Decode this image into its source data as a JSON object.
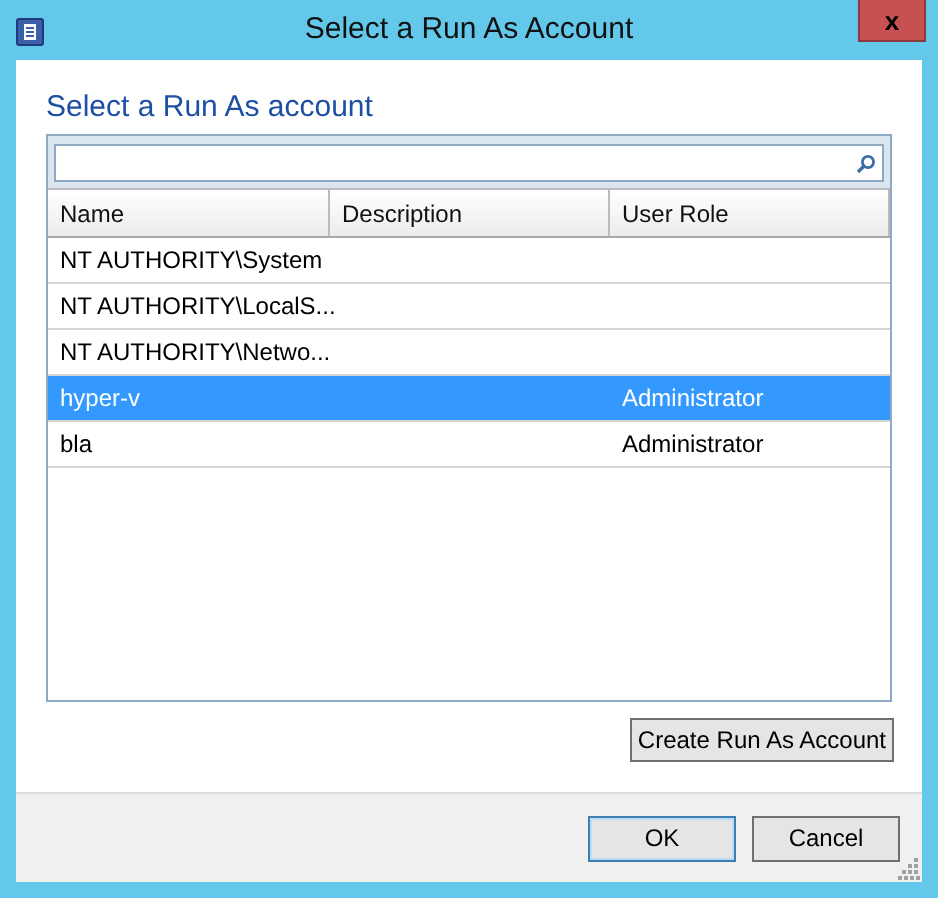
{
  "window": {
    "title": "Select a Run As Account",
    "close_label": "x"
  },
  "heading": "Select a Run As account",
  "table": {
    "columns": [
      "Name",
      "Description",
      "User Role"
    ],
    "rows": [
      {
        "name": "NT AUTHORITY\\System",
        "selected": false
      },
      {
        "name": "NT AUTHORITY\\LocalS...",
        "selected": false
      },
      {
        "name": "NT AUTHORITY\\Netwo...",
        "selected": false
      },
      {
        "name": "hyper-v",
        "user_role": "Administrator",
        "selected": true
      },
      {
        "name": "bla",
        "user_role": "Administrator",
        "selected": false
      }
    ]
  },
  "create_button": "Create Run As Account",
  "buttons": [
    {
      "label": "OK",
      "kind": "default"
    },
    {
      "label": "Cancel",
      "kind": "normal"
    }
  ]
}
